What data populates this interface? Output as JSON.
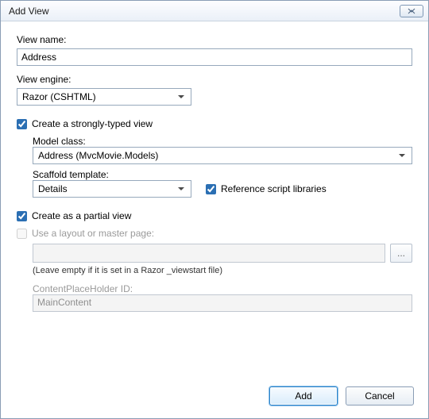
{
  "dialog": {
    "title": "Add View"
  },
  "viewName": {
    "label": "View name:",
    "value": "Address"
  },
  "viewEngine": {
    "label": "View engine:",
    "value": "Razor (CSHTML)"
  },
  "stronglyTyped": {
    "checked": true,
    "label": "Create a strongly-typed view"
  },
  "modelClass": {
    "label": "Model class:",
    "value": "Address (MvcMovie.Models)"
  },
  "scaffold": {
    "label": "Scaffold template:",
    "value": "Details"
  },
  "referenceScripts": {
    "checked": true,
    "label": "Reference script libraries"
  },
  "partialView": {
    "checked": true,
    "label": "Create as a partial view"
  },
  "useLayout": {
    "checked": false,
    "label": "Use a layout or master page:",
    "value": "",
    "hint": "(Leave empty if it is set in a Razor _viewstart file)"
  },
  "contentPlaceholder": {
    "label": "ContentPlaceHolder ID:",
    "value": "MainContent"
  },
  "buttons": {
    "add": "Add",
    "cancel": "Cancel"
  }
}
